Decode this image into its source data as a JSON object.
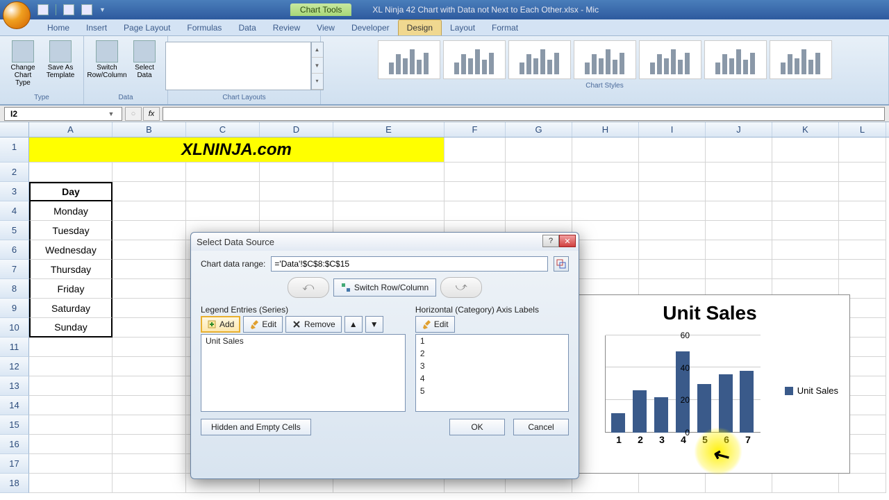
{
  "app": {
    "chart_tools_label": "Chart Tools",
    "filename": "XL Ninja 42 Chart with Data not Next to Each Other.xlsx - Mic"
  },
  "ribbon": {
    "tabs": [
      "Home",
      "Insert",
      "Page Layout",
      "Formulas",
      "Data",
      "Review",
      "View",
      "Developer",
      "Design",
      "Layout",
      "Format"
    ],
    "active_tab": "Design",
    "groups": {
      "type": {
        "label": "Type",
        "change_chart_type": "Change Chart Type",
        "save_as_template": "Save As Template"
      },
      "data": {
        "label": "Data",
        "switch_rc": "Switch Row/Column",
        "select_data": "Select Data"
      },
      "chart_layouts": {
        "label": "Chart Layouts"
      },
      "chart_styles": {
        "label": "Chart Styles"
      }
    }
  },
  "formula_bar": {
    "name_box": "I2",
    "fx": "fx",
    "formula": ""
  },
  "sheet": {
    "columns": [
      "A",
      "B",
      "C",
      "D",
      "E",
      "F",
      "G",
      "H",
      "I",
      "J",
      "K",
      "L"
    ],
    "banner": "XLNINJA.com",
    "day_header": "Day",
    "days": [
      "Monday",
      "Tuesday",
      "Wednesday",
      "Thursday",
      "Friday",
      "Saturday",
      "Sunday"
    ]
  },
  "chart_data": {
    "type": "bar",
    "title": "Unit Sales",
    "legend": "Unit Sales",
    "categories": [
      "1",
      "2",
      "3",
      "4",
      "5",
      "6",
      "7"
    ],
    "values": [
      12,
      26,
      22,
      50,
      30,
      36,
      38
    ],
    "yticks": [
      0,
      20,
      40,
      60
    ],
    "ylim": [
      0,
      60
    ],
    "xlabel": "",
    "ylabel": ""
  },
  "dialog": {
    "title": "Select Data Source",
    "range_label": "Chart data range:",
    "range_value": "='Data'!$C$8:$C$15",
    "switch_btn": "Switch Row/Column",
    "legend_label": "Legend Entries (Series)",
    "axis_label": "Horizontal (Category) Axis Labels",
    "btn_add": "Add",
    "btn_edit": "Edit",
    "btn_remove": "Remove",
    "series_items": [
      "Unit Sales"
    ],
    "axis_items": [
      "1",
      "2",
      "3",
      "4",
      "5"
    ],
    "hidden_btn": "Hidden and Empty Cells",
    "ok": "OK",
    "cancel": "Cancel"
  }
}
